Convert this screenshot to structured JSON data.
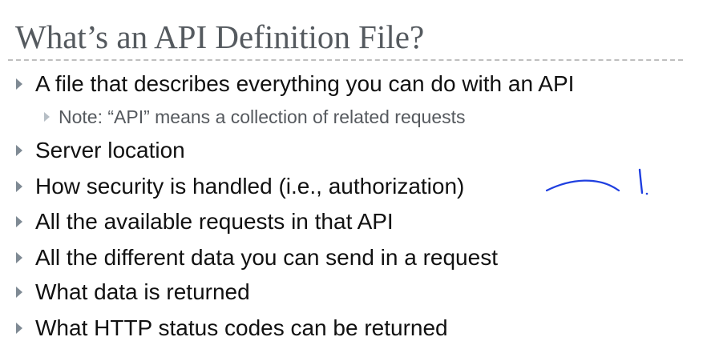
{
  "slide": {
    "title": "What’s an API Definition File?",
    "bullets": [
      "A file that describes everything you can do with an API",
      "Note: “API” means a collection of related requests",
      "Server location",
      "How security is handled (i.e., authorization)",
      "All the available requests in that API",
      "All the different data you can send in a request",
      "What data is returned",
      "What HTTP status codes can be returned"
    ]
  },
  "colors": {
    "title": "#555a5f",
    "body_text": "#111111",
    "sub_text": "#55595e",
    "bullet_marker": "#7f8a94",
    "sub_bullet_marker": "#b6bec5",
    "rule": "#bfbfbf",
    "annotation_ink": "#1f3fe0"
  }
}
